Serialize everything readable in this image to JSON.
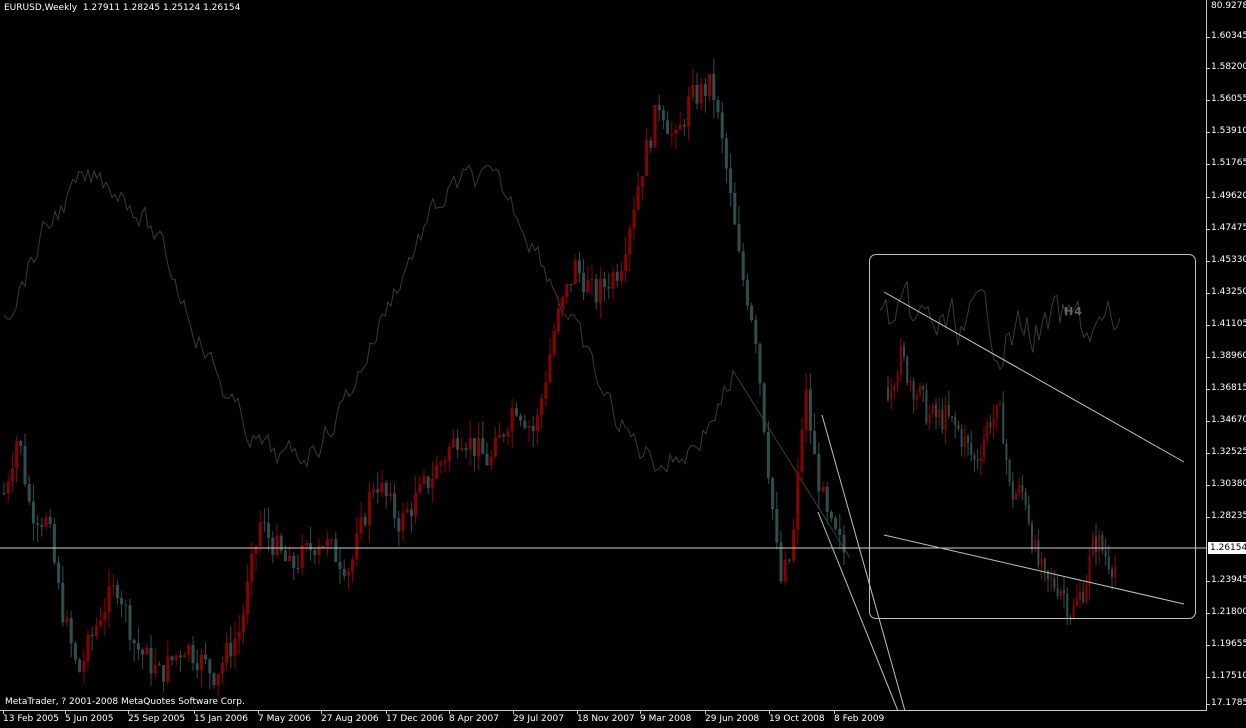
{
  "header": {
    "symbol": "EURUSD,Weekly",
    "ohlc": "1.27911 1.28245 1.25124 1.26154"
  },
  "copyright": "MetaTrader, ? 2001-2008 MetaQuotes Software Corp.",
  "inset_label": "H4",
  "price_axis": {
    "top_label": "80.9278",
    "labels": [
      "1.60345",
      "1.58200",
      "1.56055",
      "1.53910",
      "1.51765",
      "1.49620",
      "1.47475",
      "1.45330",
      "1.43250",
      "1.41105",
      "1.38960",
      "1.36815",
      "1.34670",
      "1.32525",
      "1.30380",
      "1.28235",
      "1.23945",
      "1.21800",
      "1.19655",
      "1.17510",
      "17.1785"
    ],
    "current_price": "1.26154"
  },
  "time_axis": {
    "labels": [
      "13 Feb 2005",
      "5 Jun 2005",
      "25 Sep 2005",
      "15 Jan 2006",
      "7 May 2006",
      "27 Aug 2006",
      "17 Dec 2006",
      "8 Apr 2007",
      "29 Jul 2007",
      "18 Nov 2007",
      "9 Mar 2008",
      "29 Jun 2008",
      "19 Oct 2008",
      "8 Feb 2009"
    ]
  },
  "colors": {
    "background": "#000000",
    "bull_candle": "#8b0000",
    "bear_candle": "#2f4f4f",
    "oscillator_line": "#3a3a3a",
    "trend_line": "#c0c0c0",
    "axis": "#c8c8c8",
    "text": "#ffffff"
  },
  "chart_data": {
    "type": "candlestick",
    "symbol": "EURUSD",
    "timeframe": "Weekly",
    "last_bar": {
      "open": 1.27911,
      "high": 1.28245,
      "low": 1.25124,
      "close": 1.26154
    },
    "y_range": [
      1.17,
      1.62
    ],
    "x_labels": [
      "13 Feb 2005",
      "5 Jun 2005",
      "25 Sep 2005",
      "15 Jan 2006",
      "7 May 2006",
      "27 Aug 2006",
      "17 Dec 2006",
      "8 Apr 2007",
      "29 Jul 2007",
      "18 Nov 2007",
      "9 Mar 2008",
      "29 Jun 2008",
      "19 Oct 2008",
      "8 Feb 2009"
    ],
    "close_trend": [
      [
        "13 Feb 2005",
        1.31
      ],
      [
        "5 Jun 2005",
        1.22
      ],
      [
        "25 Sep 2005",
        1.2
      ],
      [
        "15 Jan 2006",
        1.21
      ],
      [
        "7 May 2006",
        1.28
      ],
      [
        "27 Aug 2006",
        1.27
      ],
      [
        "17 Dec 2006",
        1.32
      ],
      [
        "8 Apr 2007",
        1.35
      ],
      [
        "29 Jul 2007",
        1.37
      ],
      [
        "18 Nov 2007",
        1.47
      ],
      [
        "9 Mar 2008",
        1.56
      ],
      [
        "29 Jun 2008",
        1.57
      ],
      [
        "19 Oct 2008",
        1.27
      ],
      [
        "8 Feb 2009",
        1.26
      ]
    ]
  }
}
